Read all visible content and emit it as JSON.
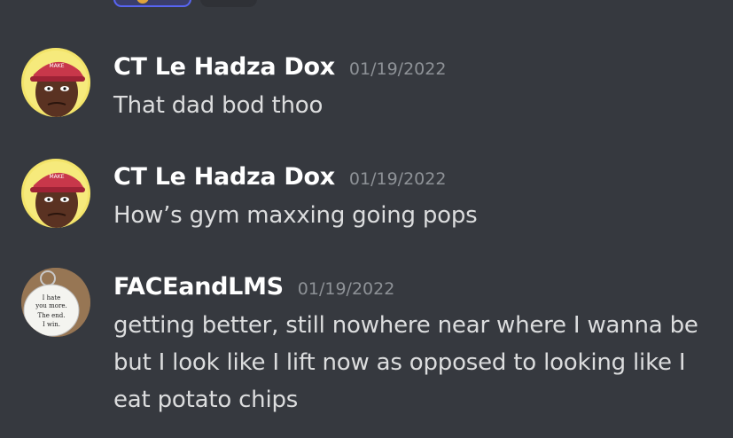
{
  "messages": [
    {
      "author": "CT Le Hadza Dox",
      "timestamp": "01/19/2022",
      "text": "That dad bod thoo",
      "avatar_icon": "cartoon-face-red-cap-avatar"
    },
    {
      "author": "CT Le Hadza Dox",
      "timestamp": "01/19/2022",
      "text": "How’s gym maxxing going pops",
      "avatar_icon": "cartoon-face-red-cap-avatar"
    },
    {
      "author": "FACEandLMS",
      "timestamp": "01/19/2022",
      "text": "getting better, still nowhere near where I wanna be but I look like I lift now as opposed to looking like I eat potato chips",
      "avatar_icon": "keychain-tag-avatar",
      "avatar_text": [
        "I hate",
        "you more.",
        "The end.",
        "I win."
      ]
    }
  ],
  "colors": {
    "background": "#36393f",
    "username": "#ffffff",
    "timestamp": "#8e9297",
    "message_text": "#dcddde",
    "reaction_active_border": "#5865f2"
  }
}
